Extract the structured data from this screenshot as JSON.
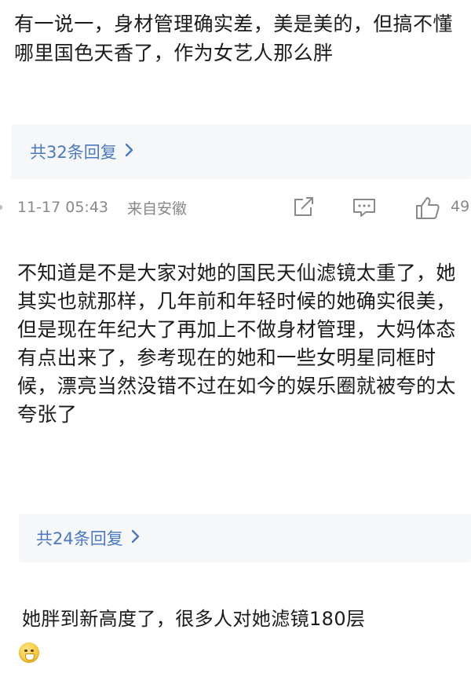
{
  "comments": [
    {
      "text": "有一说一，身材管理确实差，美是美的，但搞不懂哪里国色天香了，作为女艺人那么胖",
      "reply_count_label": "共32条回复",
      "time": "11-17 05:43",
      "location": "来自安徽",
      "like_count": "49"
    },
    {
      "text": "不知道是不是大家对她的国民天仙滤镜太重了，她其实也就那样，几年前和年轻时候的她确实很美，但是现在年纪大了再加上不做身材管理，大妈体态有点出来了，参考现在的她和一些女明星同框时候，漂亮当然没错不过在如今的娱乐圈就被夸的太夸张了",
      "reply_count_label": "共24条回复"
    },
    {
      "text": "她胖到新高度了，很多人对她滤镜180层",
      "emoji": "grimace-emoji"
    }
  ],
  "icons": {
    "chevron": "chevron-right-icon",
    "share": "share-icon",
    "comment": "comment-icon",
    "like": "thumbs-up-icon"
  },
  "colors": {
    "link": "#4a78c2",
    "meta": "#888888",
    "reply_bg": "#f6f7f9"
  }
}
